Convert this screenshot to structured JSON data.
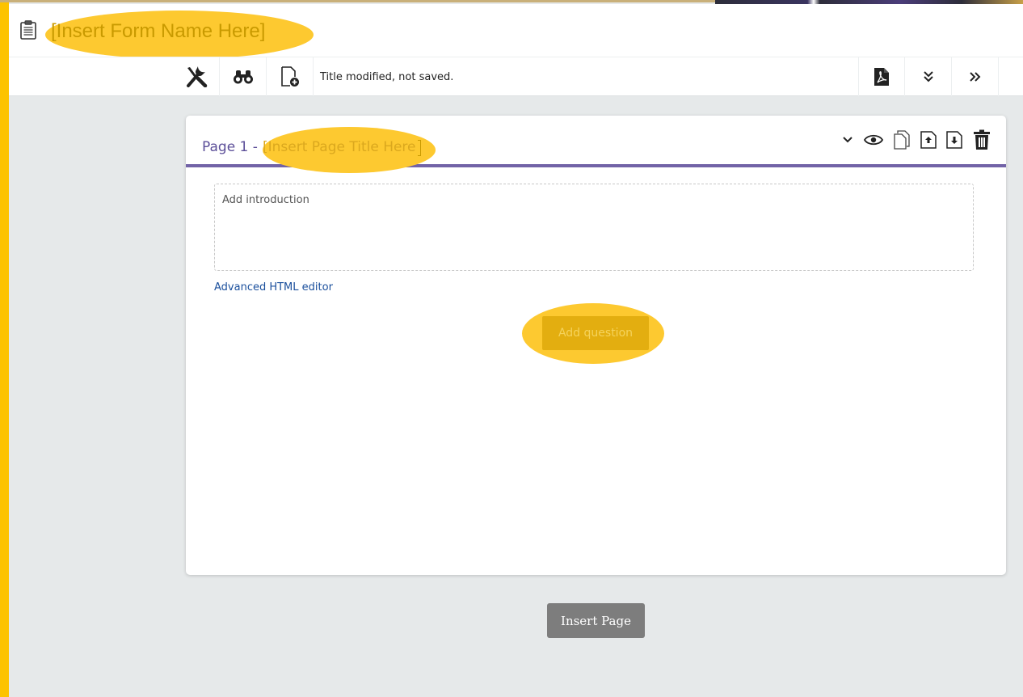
{
  "form": {
    "name": "[Insert Form Name Here]",
    "icon": "clipboard-icon"
  },
  "toolbar": {
    "left_icons": [
      "tools-icon",
      "binoculars-icon",
      "add-page-icon"
    ],
    "status": "Title modified, not saved.",
    "right_icons": [
      "pdf-icon",
      "double-chevron-down-icon",
      "double-chevron-right-icon"
    ]
  },
  "page": {
    "prefix": "Page 1 - ",
    "title": "[Insert Page Title Here",
    "actions": [
      "chevron-down-icon",
      "eye-icon",
      "copy-icon",
      "move-up-icon",
      "move-down-icon",
      "trash-icon"
    ],
    "intro_placeholder": "Add introduction",
    "advanced_link": "Advanced HTML editor",
    "add_question_label": "Add question"
  },
  "insert_page_label": "Insert Page",
  "colors": {
    "accent_bar": "#fdc300",
    "highlight": "#fdc930",
    "page_header_underline": "#7263a7",
    "link": "#1a4f9c"
  }
}
